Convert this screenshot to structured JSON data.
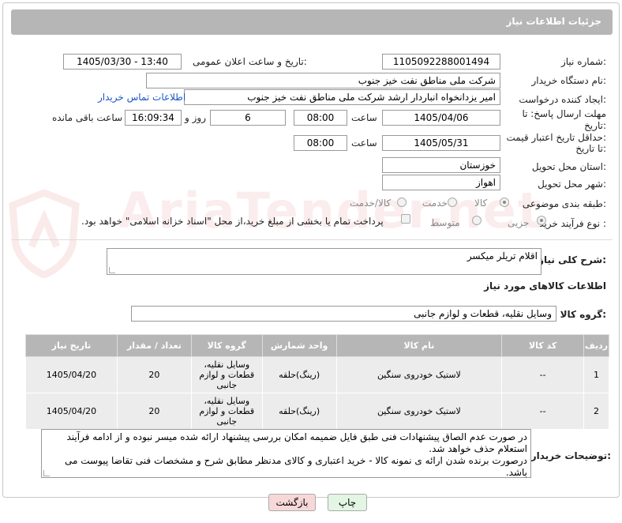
{
  "header": {
    "title": "جزئیات اطلاعات نیاز"
  },
  "fields": {
    "need_number_label": "شماره نیاز:",
    "need_number": "1105092288001494",
    "announce_label": "تاریخ و ساعت اعلان عمومی:",
    "announce_value": "1405/03/30 - 13:40",
    "buyer_org_label": "نام دستگاه خریدار:",
    "buyer_org": "شرکت ملی مناطق نفت خیز جنوب",
    "requester_label": "ایجاد کننده درخواست:",
    "requester": "امیر یزدانخواه انباردار ارشد شرکت ملی مناطق نفت خیز جنوب",
    "contact_link": "اطلاعات تماس خریدار",
    "deadline_label_1": "مهلت ارسال پاسخ: تا",
    "deadline_label_2": "تاریخ:",
    "deadline_date": "1405/04/06",
    "time_label": "ساعت",
    "deadline_time": "08:00",
    "days_value": "6",
    "days_label": "روز و",
    "remaining_time": "16:09:34",
    "remaining_label": "ساعت باقی مانده",
    "validity_label_1": "حداقل تاریخ اعتبار قیمت:",
    "validity_label_2": "تا تاریخ:",
    "validity_date": "1405/05/31",
    "validity_time": "08:00",
    "province_label": "استان محل تحویل:",
    "province": "خوزستان",
    "city_label": "شهر محل تحویل:",
    "city": "اهواز",
    "category_label": "طبقه بندی موضوعی:",
    "category_options": [
      "کالا",
      "خدمت",
      "کالا/خدمت"
    ],
    "process_label": "نوع فرآیند خرید :",
    "process_options": [
      "جزیی",
      "متوسط"
    ],
    "payment_note": "پرداخت تمام یا بخشی از مبلغ خرید،از محل \"اسناد خزانه اسلامی\" خواهد بود."
  },
  "description": {
    "label": "شرح کلی نیاز:",
    "value": "اقلام تریلر میکسر"
  },
  "goods_section": {
    "title": "اطلاعات کالاهای مورد نیاز",
    "group_label": "گروه کالا:",
    "group_value": "وسایل نقلیه، قطعات و لوازم جانبی"
  },
  "table": {
    "headers": [
      "ردیف",
      "کد کالا",
      "نام کالا",
      "واحد شمارش",
      "گروه کالا",
      "تعداد / مقدار",
      "تاریخ نیاز"
    ],
    "rows": [
      [
        "1",
        "--",
        "لاستیک خودروی سنگین",
        "(رینگ)حلقه",
        "وسایل نقلیه، قطعات و لوازم جانبی",
        "20",
        "1405/04/20"
      ],
      [
        "2",
        "--",
        "لاستیک خودروی سنگین",
        "(رینگ)حلقه",
        "وسایل نقلیه، قطعات و لوازم جانبی",
        "20",
        "1405/04/20"
      ]
    ]
  },
  "buyer_notes": {
    "label": "توضیحات خریدار:",
    "line1": "در صورت عدم الصاق پیشنهادات فنی طبق فایل ضمیمه امکان بررسی پیشنهاد ارائه شده میسر نبوده و از ادامه فرآیند استعلام حذف خواهد شد.",
    "line2": "درصورت برنده شدن ارائه ی نمونه کالا - خرید اعتباری و کالای مدنظر مطابق شرح و مشخصات فنی تقاضا پیوست می باشد."
  },
  "buttons": {
    "print": "چاپ",
    "back": "بازگشت"
  },
  "watermark": "AriaTender.net",
  "colors": {
    "header_bg": "#b6b6b6",
    "link": "#1a55c4",
    "back_btn": "#f7d8d8",
    "print_btn": "#e3f5e3"
  }
}
